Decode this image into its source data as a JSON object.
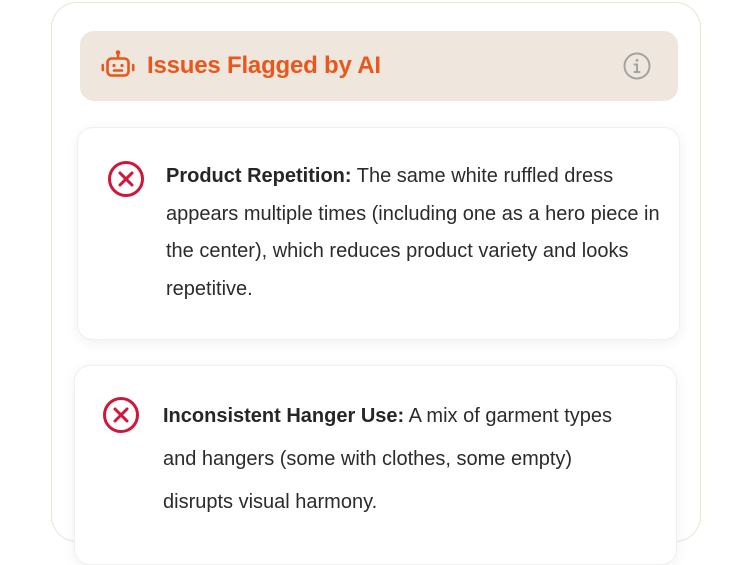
{
  "header": {
    "title": "Issues Flagged by AI",
    "title_color": "#e8581c",
    "background": "#efe7dd",
    "icon": "robot-icon",
    "info_icon": "info-icon"
  },
  "issues": [
    {
      "icon": "x-circle-icon",
      "icon_color": "#d0163a",
      "title": "Product Repetition:",
      "description": "The same white ruffled dress appears multiple times (including one as a hero piece in the center), which reduces product variety and looks repetitive."
    },
    {
      "icon": "x-circle-icon",
      "icon_color": "#d0163a",
      "title": "Inconsistent Hanger Use:",
      "description": "A mix of garment types and hangers (some with clothes, some empty) disrupts visual harmony."
    }
  ]
}
